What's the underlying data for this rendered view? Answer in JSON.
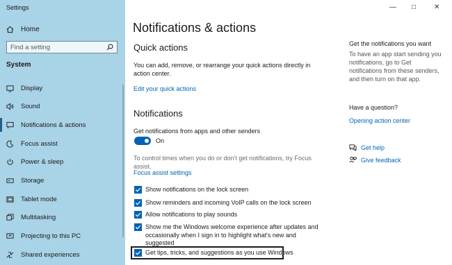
{
  "window": {
    "title": "Settings"
  },
  "sidebar": {
    "home_label": "Home",
    "search_placeholder": "Find a setting",
    "section_label": "System",
    "items": [
      {
        "label": "Display",
        "icon": "display-icon"
      },
      {
        "label": "Sound",
        "icon": "sound-icon"
      },
      {
        "label": "Notifications & actions",
        "icon": "notifications-icon",
        "selected": true
      },
      {
        "label": "Focus assist",
        "icon": "moon-icon"
      },
      {
        "label": "Power & sleep",
        "icon": "power-icon"
      },
      {
        "label": "Storage",
        "icon": "storage-icon"
      },
      {
        "label": "Tablet mode",
        "icon": "tablet-icon"
      },
      {
        "label": "Multitasking",
        "icon": "multitasking-icon"
      },
      {
        "label": "Projecting to this PC",
        "icon": "projector-icon"
      },
      {
        "label": "Shared experiences",
        "icon": "shared-icon"
      }
    ]
  },
  "main": {
    "title": "Notifications & actions",
    "quick_actions": {
      "heading": "Quick actions",
      "description_line1": "You can add, remove, or rearrange your quick actions directly in",
      "description_line2": "action center.",
      "edit_link": "Edit your quick actions"
    },
    "notifications": {
      "heading": "Notifications",
      "get_notifications_label": "Get notifications from apps and other senders",
      "toggle_state": "On",
      "focus_note_line1": "To control times when you do or don't get notifications, try Focus",
      "focus_note_line2": "assist.",
      "focus_link": "Focus assist settings",
      "checkboxes": [
        {
          "label": "Show notifications on the lock screen",
          "checked": true
        },
        {
          "label": "Show reminders and incoming VoIP calls on the lock screen",
          "checked": true
        },
        {
          "label": "Allow notifications to play sounds",
          "checked": true
        },
        {
          "label_line1": "Show me the Windows welcome experience after updates and",
          "label_line2": "occasionally when I sign in to highlight what's new and",
          "label_line3": "suggested",
          "checked": true
        },
        {
          "label": "Get tips, tricks, and suggestions as you use Windows",
          "checked": true
        }
      ]
    }
  },
  "right_panel": {
    "get_notif_heading": "Get the notifications you want",
    "get_notif_text": "To have an app start sending you notifications, go to Get notifications from these senders, and then turn on that app.",
    "question_heading": "Have a question?",
    "action_center_link": "Opening action center",
    "get_help_link": "Get help",
    "feedback_link": "Give feedback"
  },
  "colors": {
    "sidebar_bg": "#a9d3e6",
    "accent": "#0063b1",
    "link": "#0064b5"
  }
}
